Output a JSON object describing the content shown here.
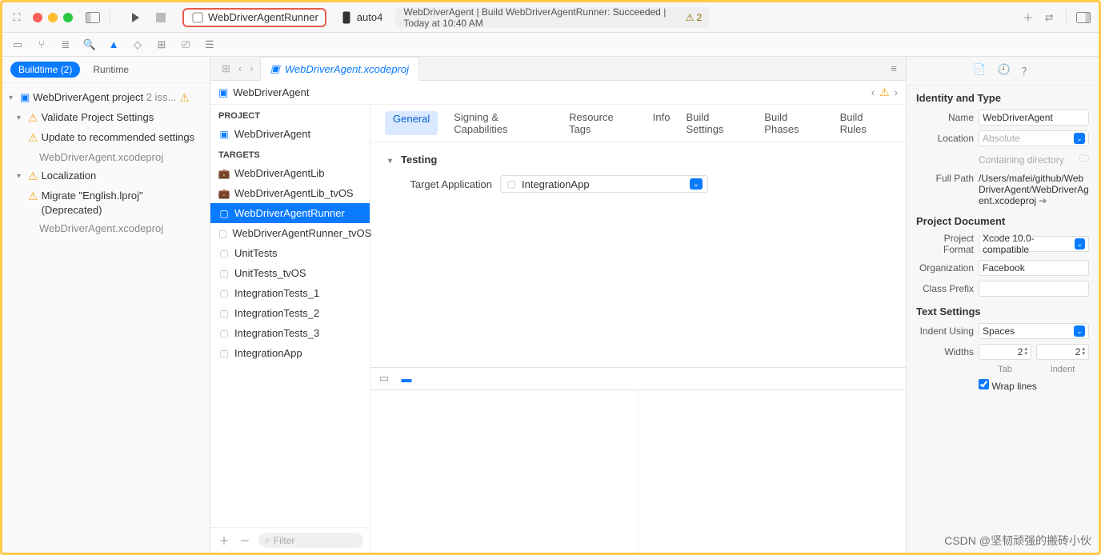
{
  "toolbar": {
    "scheme": "WebDriverAgentRunner",
    "device": "auto4",
    "status_prefix": "WebDriverAgent | Build WebDriverAgentRunner:",
    "status_result": "Succeeded",
    "status_time": "Today at 10:40 AM",
    "warn_count": "2"
  },
  "left": {
    "buildtime_label": "Buildtime (2)",
    "runtime_label": "Runtime",
    "tree": {
      "root": "WebDriverAgent project",
      "root_suffix": "2 iss...",
      "group1": "Validate Project Settings",
      "issue1": "Update to recommended settings",
      "issue1_sub": "WebDriverAgent.xcodeproj",
      "group2": "Localization",
      "issue2": "Migrate \"English.lproj\" (Deprecated)",
      "issue2_sub": "WebDriverAgent.xcodeproj"
    }
  },
  "center": {
    "doc_tab": "WebDriverAgent.xcodeproj",
    "crumb": "WebDriverAgent",
    "project_header": "PROJECT",
    "project_item": "WebDriverAgent",
    "targets_header": "TARGETS",
    "targets": [
      "WebDriverAgentLib",
      "WebDriverAgentLib_tvOS",
      "WebDriverAgentRunner",
      "WebDriverAgentRunner_tvOS",
      "UnitTests",
      "UnitTests_tvOS",
      "IntegrationTests_1",
      "IntegrationTests_2",
      "IntegrationTests_3",
      "IntegrationApp"
    ],
    "filter_placeholder": "Filter",
    "editor_tabs": [
      "General",
      "Signing & Capabilities",
      "Resource Tags",
      "Info",
      "Build Settings",
      "Build Phases",
      "Build Rules"
    ],
    "section_title": "Testing",
    "target_app_label": "Target Application",
    "target_app_value": "IntegrationApp"
  },
  "right": {
    "h1": "Identity and Type",
    "name_label": "Name",
    "name_value": "WebDriverAgent",
    "location_label": "Location",
    "location_value": "Absolute",
    "containing_note": "Containing directory",
    "fullpath_label": "Full Path",
    "fullpath_value": "/Users/mafei/github/WebDriverAgent/WebDriverAgent.xcodeproj",
    "h2": "Project Document",
    "format_label": "Project Format",
    "format_value": "Xcode 10.0-compatible",
    "org_label": "Organization",
    "org_value": "Facebook",
    "prefix_label": "Class Prefix",
    "prefix_value": "",
    "h3": "Text Settings",
    "indent_label": "Indent Using",
    "indent_value": "Spaces",
    "widths_label": "Widths",
    "tab_val": "2",
    "tab_label": "Tab",
    "indent_val": "2",
    "indent_label2": "Indent",
    "wrap_label": "Wrap lines"
  },
  "watermark": "CSDN @坚韧顽强的搬砖小伙"
}
